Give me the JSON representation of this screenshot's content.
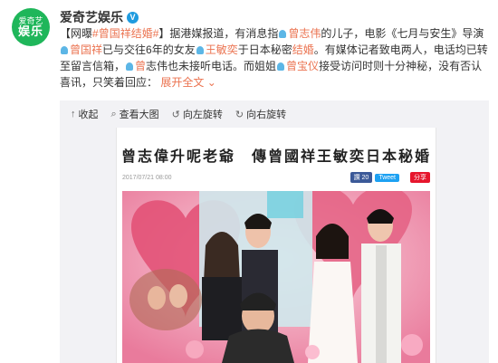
{
  "account": {
    "avatar_small": "爱奇艺",
    "avatar_big": "娱乐",
    "name": "爱奇艺娱乐"
  },
  "post": {
    "prefix": "【网曝",
    "topic": "#曾国祥结婚#",
    "seg1": "】据港媒报道，有消息指",
    "p1": "曾志伟",
    "seg2": "的儿子，电影《七月与安生》导演",
    "p2": "曾国祥",
    "seg3": "已与交往6年的女友",
    "p3": "王敏奕",
    "seg4": "于日本秘密",
    "link1": "结婚",
    "seg5": "。有媒体记者致电两人，电话均已转至留言信箱，",
    "p4": "曾",
    "seg6": "志伟也未接听电话。而姐姐",
    "p5": "曾宝仪",
    "seg7": "接受访问时则十分神秘，没有否认喜讯，只笑着回应：",
    "expand": "展开全文"
  },
  "toolbar": {
    "collapse": "收起",
    "view_large": "查看大图",
    "rotate_left": "向左旋转",
    "rotate_right": "向右旋转"
  },
  "article": {
    "headline": "曾志偉升呢老爺　傳曾國祥王敏奕日本秘婚",
    "date": "2017/07/21 08:00",
    "fb_label": "讚 20",
    "tw_label": "Tweet",
    "share_label": "分享"
  },
  "colors": {
    "accent": "#eb7350",
    "brand_green": "#1fb65a",
    "verified_blue": "#1e9bdf"
  }
}
